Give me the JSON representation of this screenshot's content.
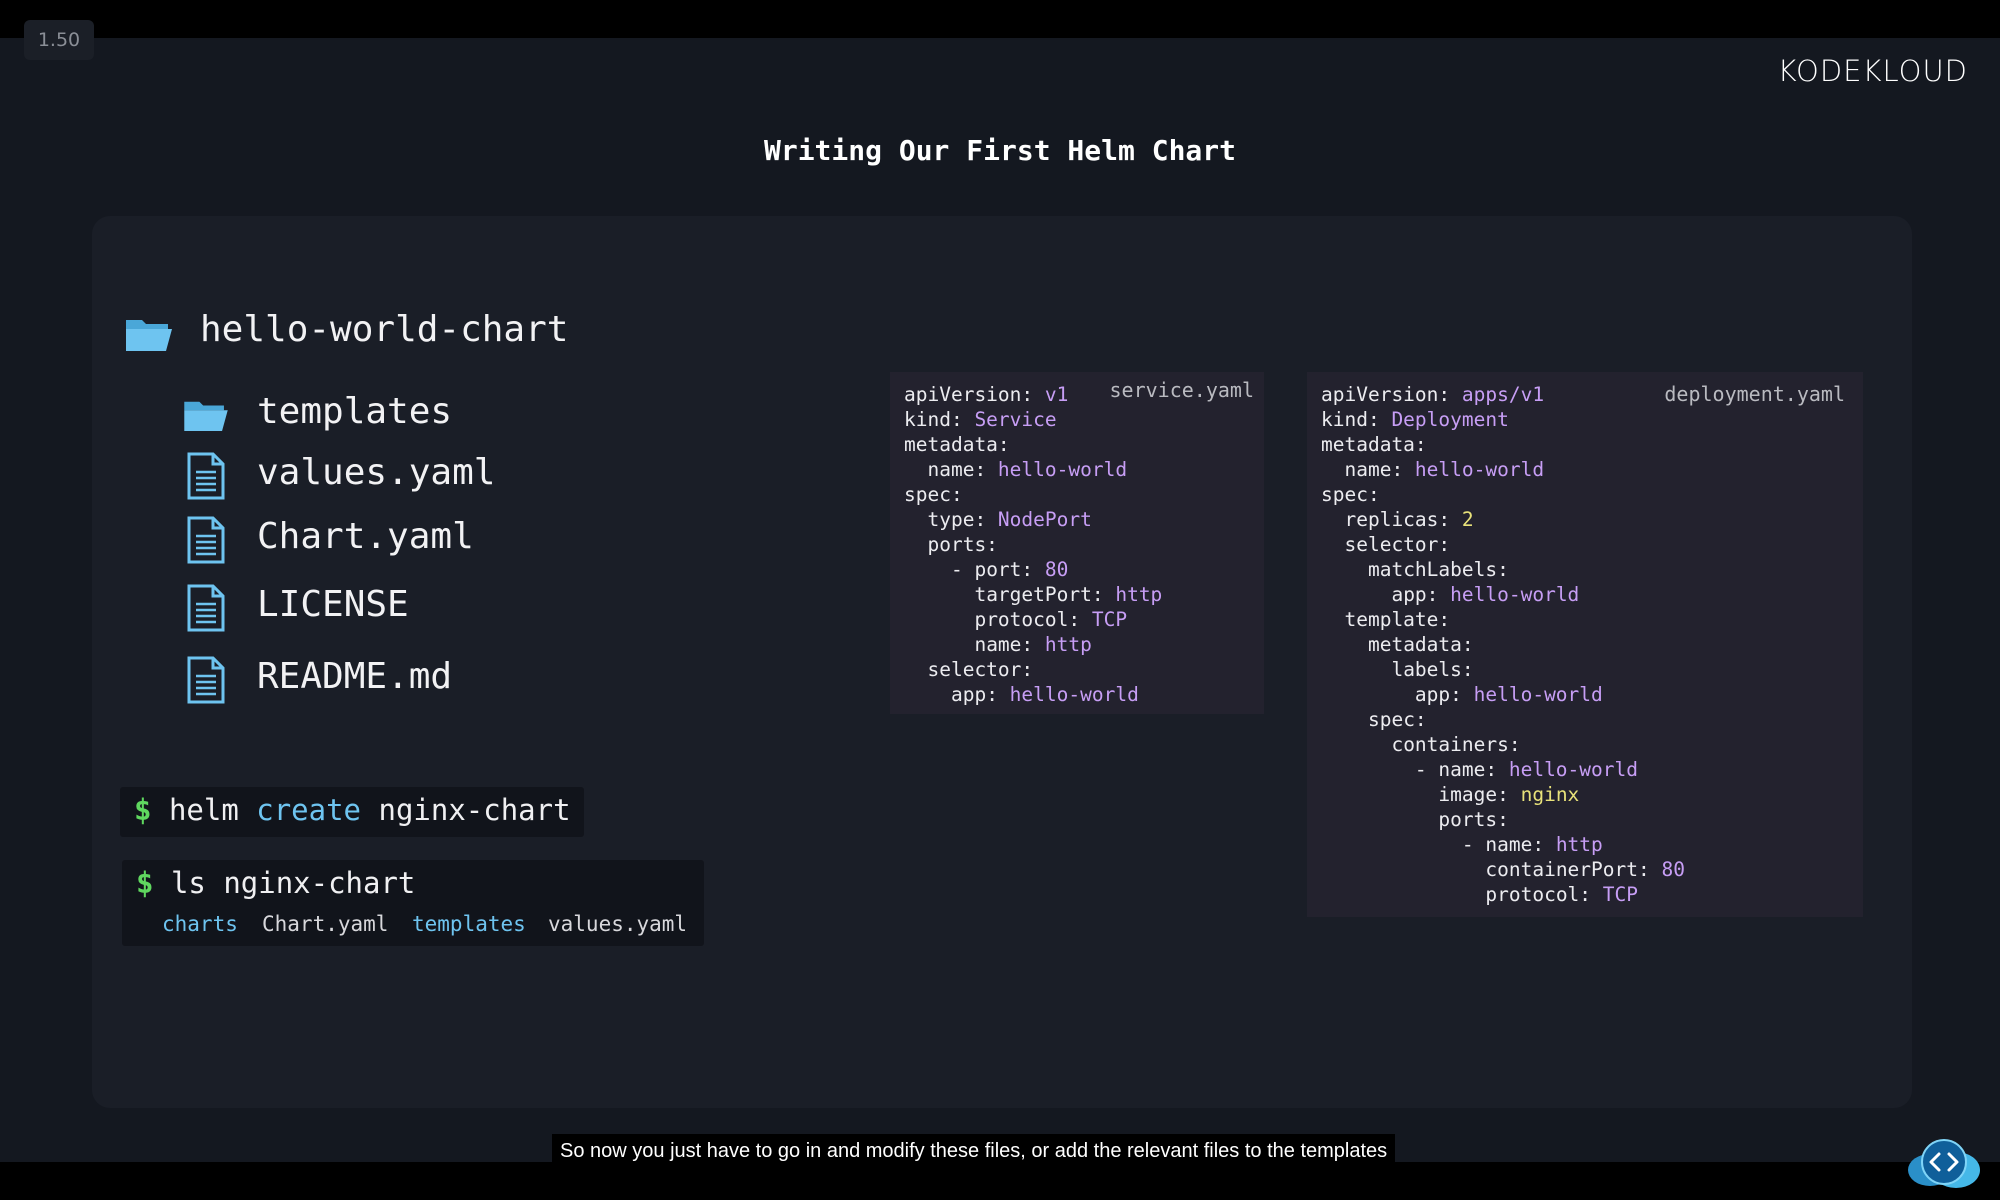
{
  "playback": {
    "speed": "1.50"
  },
  "brand": {
    "logo": "KODEKLOUD"
  },
  "slide": {
    "title": "Writing Our First Helm Chart"
  },
  "tree": {
    "root": "hello-world-chart",
    "items": [
      {
        "label": "templates",
        "icon": "folder-icon"
      },
      {
        "label": "values.yaml",
        "icon": "file-icon"
      },
      {
        "label": "Chart.yaml",
        "icon": "file-icon"
      },
      {
        "label": "LICENSE",
        "icon": "file-icon"
      },
      {
        "label": "README.md",
        "icon": "file-icon"
      }
    ]
  },
  "terminal": {
    "cmd1": {
      "prompt": "$",
      "cmd": "helm",
      "sub": "create",
      "arg": "nginx-chart"
    },
    "cmd2": {
      "prompt": "$",
      "cmd": "ls",
      "arg": "nginx-chart"
    },
    "ls_output": [
      {
        "name": "charts",
        "type": "dir"
      },
      {
        "name": "Chart.yaml",
        "type": "file"
      },
      {
        "name": "templates",
        "type": "dir"
      },
      {
        "name": "values.yaml",
        "type": "file"
      }
    ]
  },
  "service_yaml": {
    "filename": "service.yaml",
    "lines": [
      "apiVersion: v1",
      "kind: Service",
      "metadata:",
      "  name: hello-world",
      "spec:",
      "  type: NodePort",
      "  ports:",
      "    - port: 80",
      "      targetPort: http",
      "      protocol: TCP",
      "      name: http",
      "  selector:",
      "    app: hello-world"
    ]
  },
  "deployment_yaml": {
    "filename": "deployment.yaml",
    "lines": [
      "apiVersion: apps/v1",
      "kind: Deployment",
      "metadata:",
      "  name: hello-world",
      "spec:",
      "  replicas: 2",
      "  selector:",
      "    matchLabels:",
      "      app: hello-world",
      "  template:",
      "    metadata:",
      "      labels:",
      "        app: hello-world",
      "    spec:",
      "      containers:",
      "        - name: hello-world",
      "          image: nginx",
      "          ports:",
      "            - name: http",
      "              containerPort: 80",
      "              protocol: TCP"
    ]
  },
  "caption": {
    "text": "So now you just have to go in and modify these files, or add the relevant files to the templates"
  },
  "colors": {
    "background": "#141820",
    "panel": "#1a1e27",
    "code_bg": "#23222e",
    "prompt": "#5fd75f",
    "keyword": "#6ec4f0",
    "yaml_value": "#c79ef5",
    "yaml_number": "#e8e27a",
    "folder": "#6ec4f0"
  },
  "icons": {
    "code_button": "code-brackets-icon"
  }
}
